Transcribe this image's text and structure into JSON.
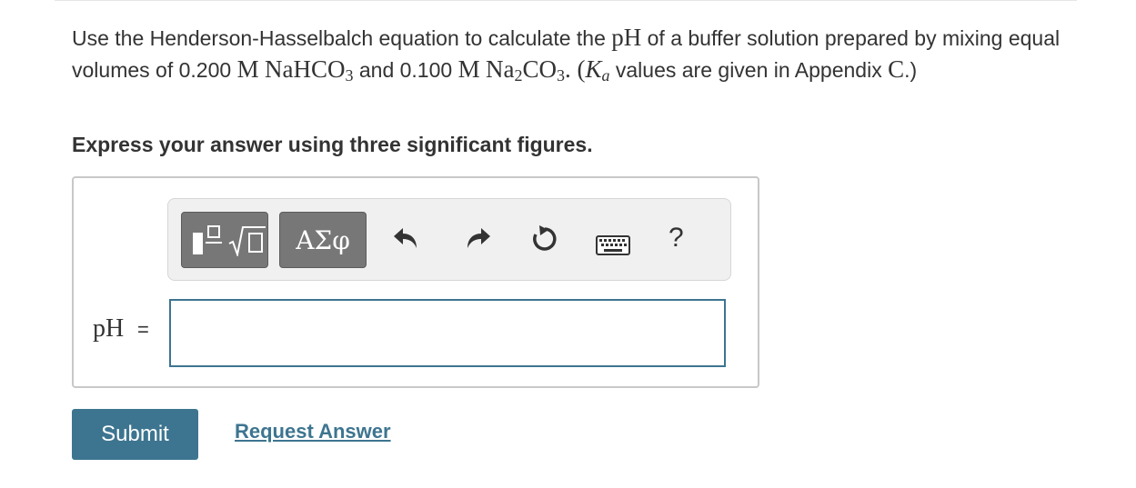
{
  "question": {
    "intro": "Use the Henderson-Hasselbalch equation to calculate the ",
    "ph_math": "pH",
    "middle": " of a buffer solution prepared by mixing equal volumes of 0.200 ",
    "unit_m1": "M",
    "formula1_main": "NaHCO",
    "formula1_sub": "3",
    "and_text": " and 0.100 ",
    "unit_m2": "M",
    "formula2_a": "Na",
    "formula2_sub1": "2",
    "formula2_b": "CO",
    "formula2_sub2": "3",
    "period_paren": ". (",
    "ka_main": "K",
    "ka_sub": "a",
    "tail": " values are given in Appendix ",
    "appendix_letter": "C",
    "end": ".)"
  },
  "instruction": "Express your answer using three significant figures.",
  "toolbar": {
    "greek_label": "ΑΣφ",
    "help_label": "?",
    "icons": [
      "templates-icon",
      "undo-icon",
      "redo-icon",
      "reset-icon",
      "keyboard-icon",
      "help-icon"
    ]
  },
  "answer": {
    "label": "pH",
    "equals": "=",
    "value": "",
    "placeholder": ""
  },
  "actions": {
    "submit_label": "Submit",
    "request_label": "Request Answer"
  },
  "colors": {
    "accent": "#3d7590",
    "toolbar_button": "#777777",
    "toolbar_bg": "#f0f0f0",
    "text": "#333333"
  }
}
